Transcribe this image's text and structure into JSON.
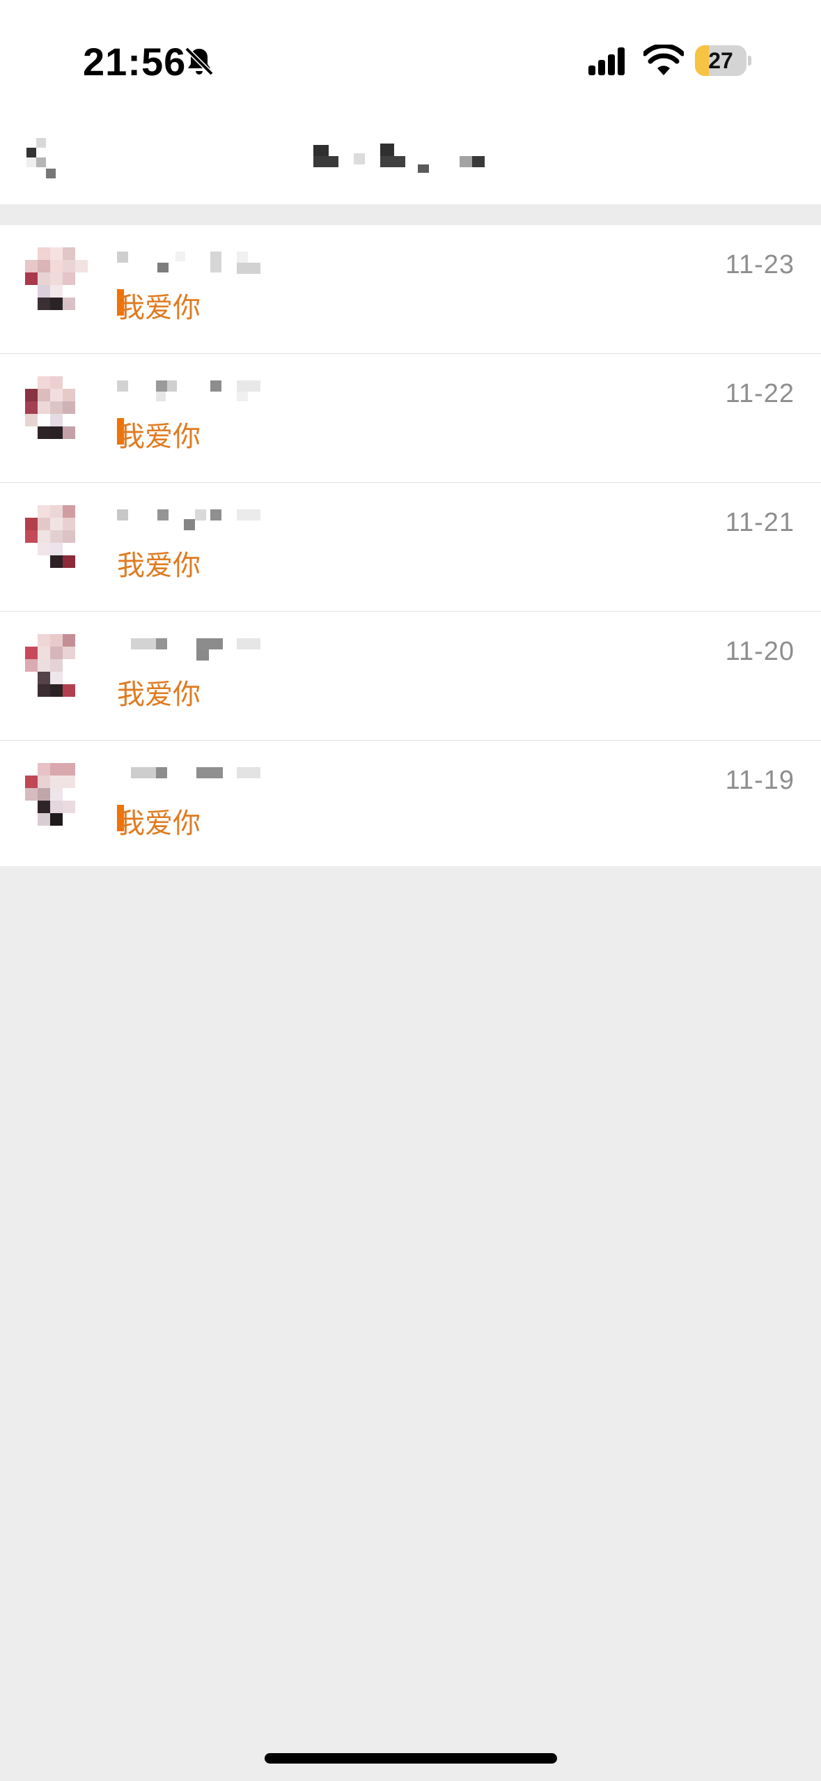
{
  "status_bar": {
    "time": "21:56",
    "battery": "27",
    "battery_level": 0.27,
    "icons": [
      "bell-slash-icon",
      "signal-icon",
      "wifi-icon",
      "battery-icon"
    ]
  },
  "navigation": {
    "back_icon": "chevron-left-icon",
    "title_redacted": true
  },
  "messages": [
    {
      "message": "我爱你",
      "date": "11-23",
      "cursor_mark": true
    },
    {
      "message": "我爱你",
      "date": "11-22",
      "cursor_mark": true
    },
    {
      "message": "我爱你",
      "date": "11-21",
      "cursor_mark": false
    },
    {
      "message": "我爱你",
      "date": "11-20",
      "cursor_mark": false
    },
    {
      "message": "我爱你",
      "date": "11-19",
      "cursor_mark": true
    }
  ],
  "colors": {
    "message_text": "#e07b22",
    "cursor_mark": "#f27100",
    "date_text": "#8e8e8e",
    "background": "#ededed"
  }
}
